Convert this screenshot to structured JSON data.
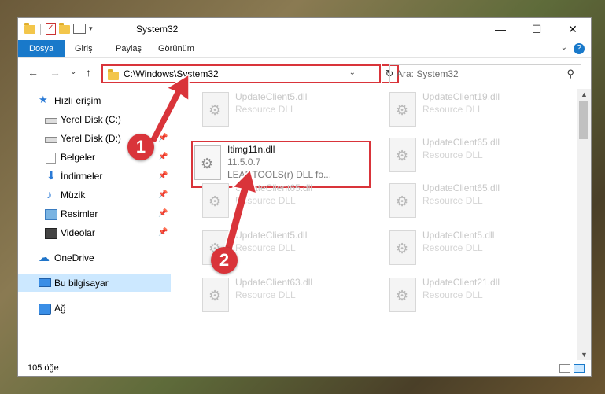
{
  "window": {
    "title": "System32"
  },
  "window_controls": {
    "minimize": "—",
    "maximize": "☐",
    "close": "✕"
  },
  "ribbon": {
    "tabs": [
      "Dosya",
      "Giriş",
      "Paylaş",
      "Görünüm"
    ],
    "help": "?"
  },
  "address": {
    "path": "C:\\Windows\\System32",
    "refresh": "↻"
  },
  "search": {
    "placeholder": "Ara: System32"
  },
  "nav_buttons": {
    "back": "←",
    "forward": "→",
    "recent": "⌄",
    "up": "↑"
  },
  "sidebar": {
    "items": [
      {
        "label": "Hızlı erişim",
        "icon": "star-icon",
        "pinned": false
      },
      {
        "label": "Yerel Disk (C:)",
        "icon": "drive-icon",
        "pinned": true
      },
      {
        "label": "Yerel Disk (D:)",
        "icon": "drive-icon",
        "pinned": true
      },
      {
        "label": "Belgeler",
        "icon": "documents-icon",
        "pinned": true
      },
      {
        "label": "İndirmeler",
        "icon": "download-icon",
        "pinned": true
      },
      {
        "label": "Müzik",
        "icon": "music-icon",
        "pinned": true
      },
      {
        "label": "Resimler",
        "icon": "pictures-icon",
        "pinned": true
      },
      {
        "label": "Videolar",
        "icon": "videos-icon",
        "pinned": true
      },
      {
        "label": "OneDrive",
        "icon": "cloud-icon",
        "pinned": false
      },
      {
        "label": "Bu bilgisayar",
        "icon": "computer-icon",
        "pinned": false
      },
      {
        "label": "Ağ",
        "icon": "network-icon",
        "pinned": false
      }
    ]
  },
  "files": {
    "selected": {
      "name": "Itimg11n.dll",
      "version": "11.5.0.7",
      "description": "LEADTOOLS(r) DLL fo..."
    },
    "faded": [
      {
        "name": "UpdateClient5.dll",
        "desc": "Resource DLL"
      },
      {
        "name": "UpdateClient19.dll",
        "desc": "Resource DLL"
      },
      {
        "name": "UpdateClient65.dll",
        "desc": "Resource DLL"
      },
      {
        "name": "UpdateClient65.dll",
        "desc": "Resource DLL"
      },
      {
        "name": "UpdateClient65.dll",
        "desc": "Resource DLL"
      },
      {
        "name": "UpdateClient5.dll",
        "desc": "Resource DLL"
      },
      {
        "name": "UpdateClient5.dll",
        "desc": "Resource DLL"
      },
      {
        "name": "UpdateClient63.dll",
        "desc": "Resource DLL"
      },
      {
        "name": "UpdateClient21.dll",
        "desc": "Resource DLL"
      }
    ]
  },
  "status": {
    "count": "105 öğe"
  },
  "annotations": {
    "step1": "1",
    "step2": "2"
  },
  "colors": {
    "accent": "#1979ca",
    "highlight": "#d9343a",
    "selection": "#cce8ff"
  }
}
